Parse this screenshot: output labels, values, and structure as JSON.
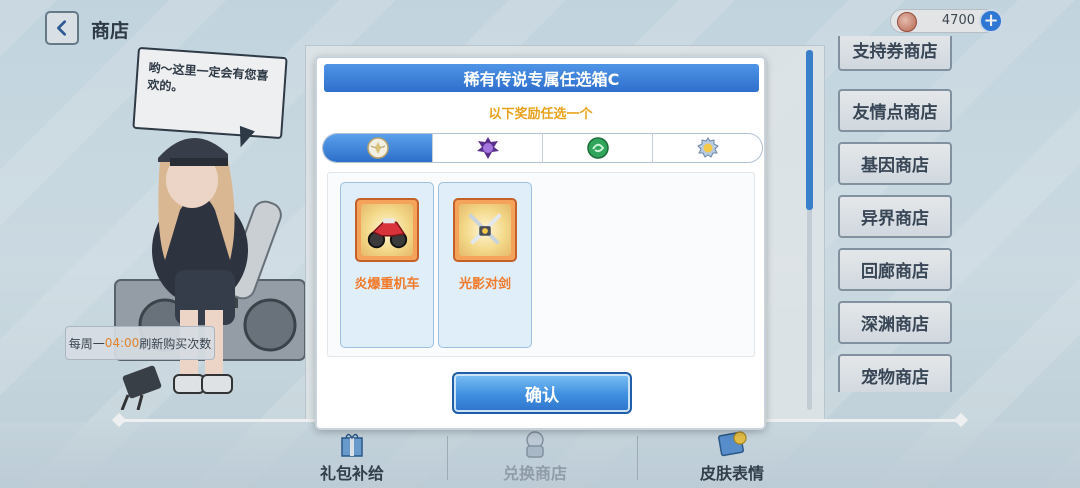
{
  "header": {
    "title": "商店",
    "currency_amount": "4700"
  },
  "character": {
    "speech": "哟～这里一定会有您喜欢的。",
    "refresh_prefix": "每周一",
    "refresh_time": "04:00",
    "refresh_suffix": "刷新购买次数"
  },
  "shop_list": {
    "items": [
      "支持券商店",
      "友情点商店",
      "基因商店",
      "异界商店",
      "回廊商店",
      "深渊商店",
      "宠物商店"
    ]
  },
  "bottom_tabs": [
    {
      "label": "礼包补给",
      "icon": "gift-icon"
    },
    {
      "label": "兑换商店",
      "icon": "exchange-icon",
      "active": true
    },
    {
      "label": "皮肤表情",
      "icon": "skin-icon"
    }
  ],
  "modal": {
    "title": "稀有传说专属任选箱C",
    "subtitle": "以下奖励任选一个",
    "tabs": [
      {
        "icon": "wing-emblem-icon",
        "active": true
      },
      {
        "icon": "purple-rune-icon"
      },
      {
        "icon": "green-swirl-icon"
      },
      {
        "icon": "gold-gear-icon"
      }
    ],
    "items": [
      {
        "name": "炎爆重机车",
        "icon": "motorcycle-icon"
      },
      {
        "name": "光影对剑",
        "icon": "twin-swords-icon"
      }
    ],
    "confirm_label": "确认"
  },
  "colors": {
    "accent": "#2e6fcc",
    "item_name": "#f07a2a",
    "subtitle": "#e8a21d"
  }
}
